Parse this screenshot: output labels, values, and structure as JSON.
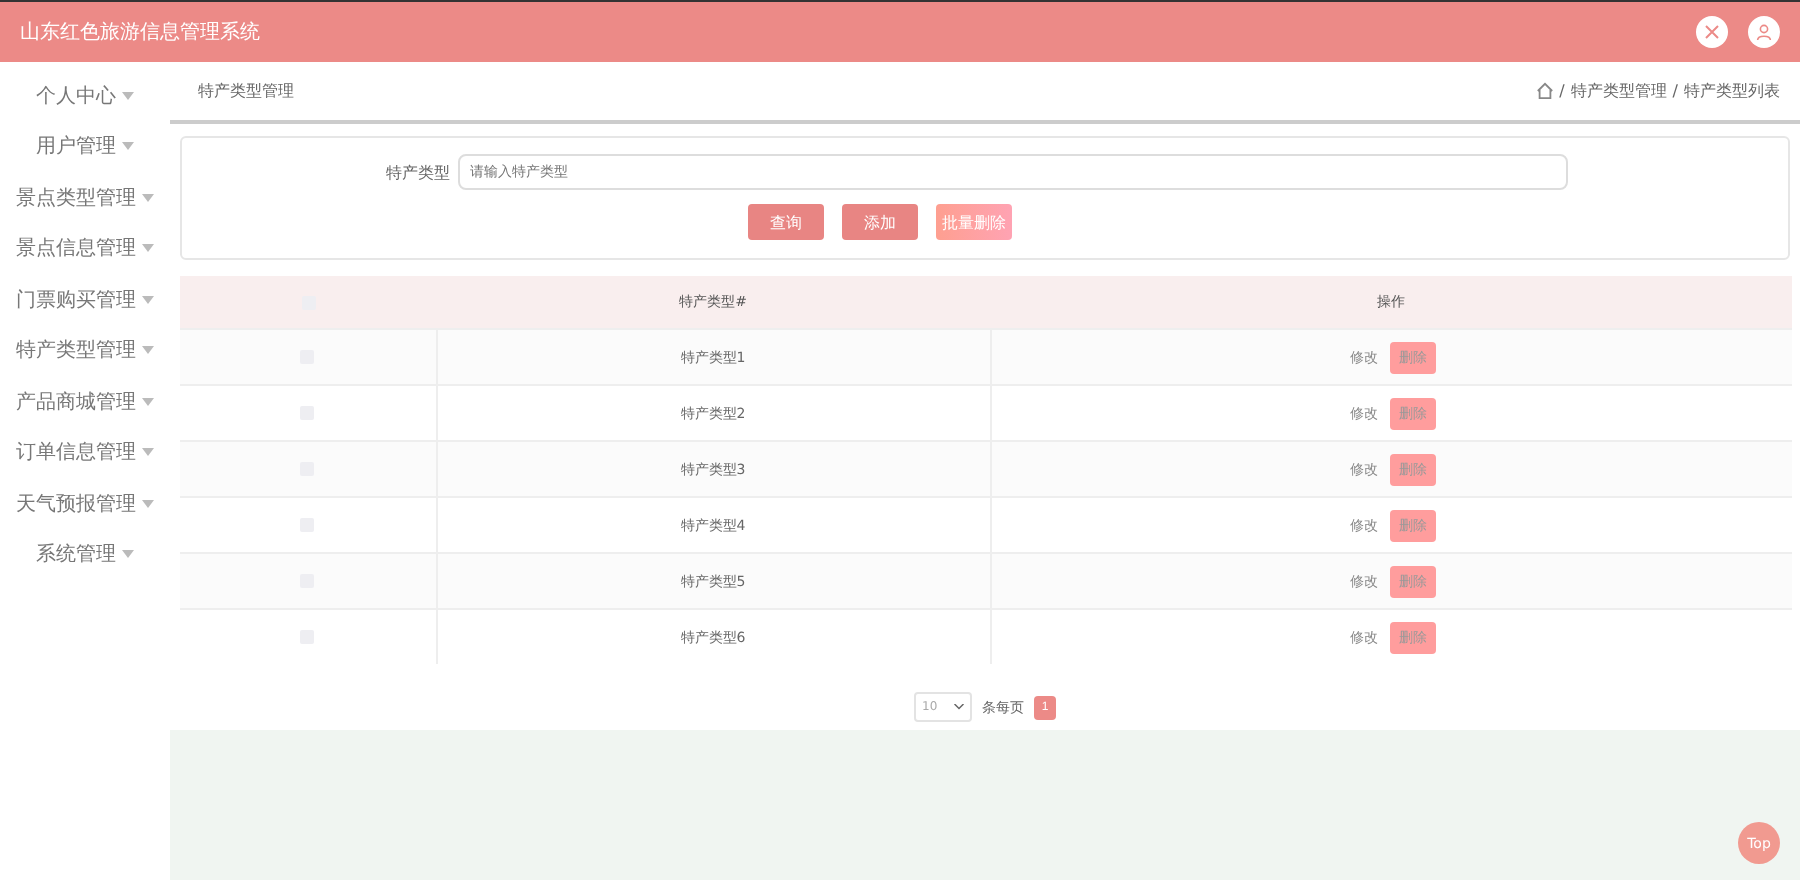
{
  "header": {
    "title": "山东红色旅游信息管理系统"
  },
  "sidebar": {
    "items": [
      {
        "label": "个人中心",
        "expanded": false
      },
      {
        "label": "用户管理",
        "expanded": false
      },
      {
        "label": "景点类型管理",
        "expanded": false
      },
      {
        "label": "景点信息管理",
        "expanded": false
      },
      {
        "label": "门票购买管理",
        "expanded": false
      },
      {
        "label": "特产类型管理",
        "expanded": false
      },
      {
        "label": "产品商城管理",
        "expanded": false
      },
      {
        "label": "订单信息管理",
        "expanded": false
      },
      {
        "label": "天气预报管理",
        "expanded": false
      },
      {
        "label": "系统管理",
        "expanded": false
      }
    ]
  },
  "page_title": "特产类型管理",
  "breadcrumb": [
    {
      "separator": "/",
      "label": "特产类型管理"
    },
    {
      "separator": "/",
      "label": "特产类型列表"
    }
  ],
  "search": {
    "label": "特产类型",
    "placeholder": "请输入特产类型",
    "buttons": [
      {
        "label": "查询",
        "kind": "primary"
      },
      {
        "label": "添加",
        "kind": "primary"
      },
      {
        "label": "批量删除",
        "kind": "danger"
      }
    ]
  },
  "table": {
    "header_checked": false,
    "columns": [
      "特产类型#",
      "操作"
    ],
    "rows": [
      {
        "checked": false,
        "name": "特产类型1",
        "edit": "修改",
        "delete": "删除"
      },
      {
        "checked": false,
        "name": "特产类型2",
        "edit": "修改",
        "delete": "删除"
      },
      {
        "checked": false,
        "name": "特产类型3",
        "edit": "修改",
        "delete": "删除"
      },
      {
        "checked": false,
        "name": "特产类型4",
        "edit": "修改",
        "delete": "删除"
      },
      {
        "checked": false,
        "name": "特产类型5",
        "edit": "修改",
        "delete": "删除"
      },
      {
        "checked": false,
        "name": "特产类型6",
        "edit": "修改",
        "delete": "删除"
      }
    ]
  },
  "pagination": {
    "page_size": "10",
    "page_size_label": "条每页",
    "pages": [
      {
        "label": "1",
        "selected": true
      }
    ]
  },
  "top_button": "Top"
}
